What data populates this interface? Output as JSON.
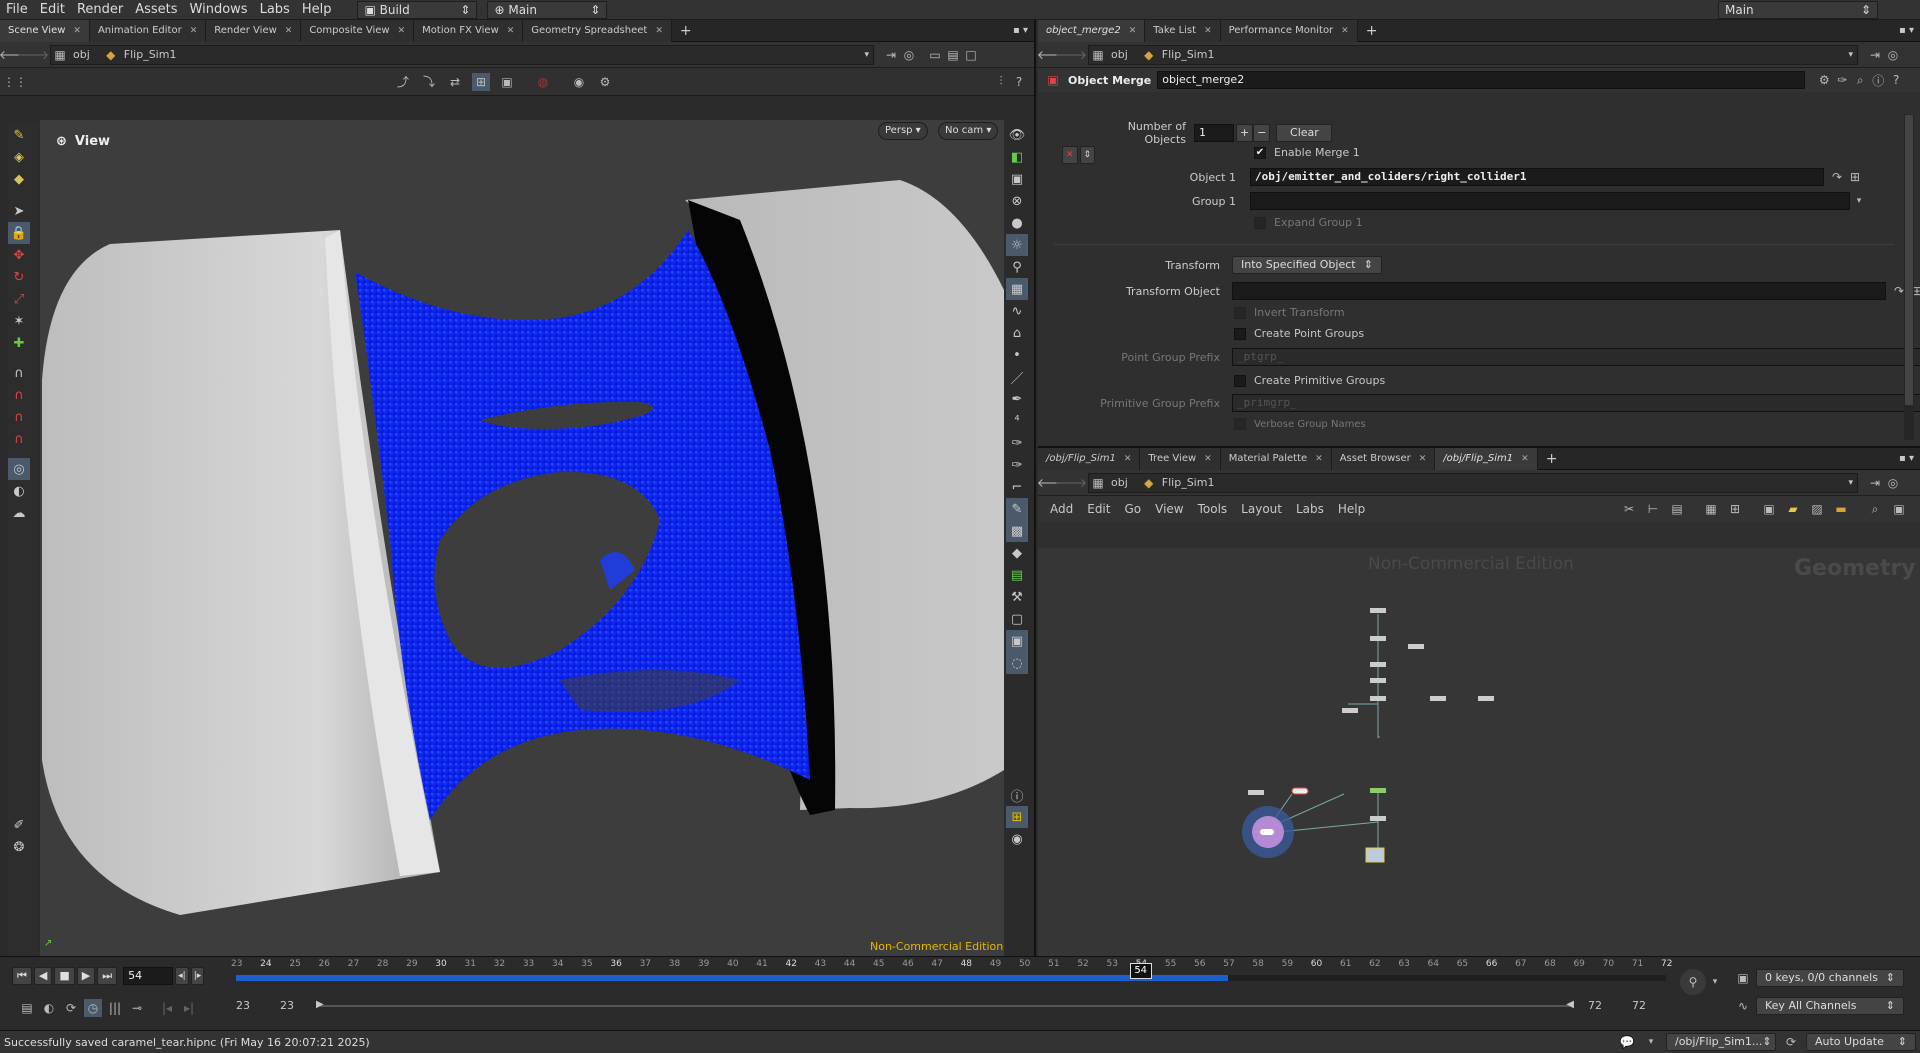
{
  "menubar": {
    "items": [
      "File",
      "Edit",
      "Render",
      "Assets",
      "Windows",
      "Labs",
      "Help"
    ],
    "desktop": "Build",
    "network": "Main",
    "right_desktop": "Main"
  },
  "left_tabs": [
    "Scene View",
    "Animation Editor",
    "Render View",
    "Composite View",
    "Motion FX View",
    "Geometry Spreadsheet"
  ],
  "right_top_tabs": [
    "object_merge2",
    "Take List",
    "Performance Monitor"
  ],
  "right_bottom_tabs": [
    "/obj/Flip_Sim1",
    "Tree View",
    "Material Palette",
    "Asset Browser",
    "/obj/Flip_Sim1"
  ],
  "path": {
    "root": "obj",
    "node": "Flip_Sim1"
  },
  "viewport": {
    "title": "View",
    "persp": "Persp",
    "cam": "No cam",
    "watermark": "Non-Commercial Edition",
    "particle_color": "#0a1fe0"
  },
  "params": {
    "node_type": "Object Merge",
    "node_name": "object_merge2",
    "num_objects_label": "Number of Objects",
    "num_objects": "1",
    "clear": "Clear",
    "enable_merge": "Enable Merge 1",
    "object1_label": "Object 1",
    "object1_value": "/obj/emitter_and_coliders/right_collider1",
    "group1_label": "Group 1",
    "expand_group": "Expand Group 1",
    "transform_label": "Transform",
    "transform_value": "Into Specified Object",
    "transform_object_label": "Transform Object",
    "invert_transform": "Invert Transform",
    "create_point_groups": "Create Point Groups",
    "point_group_prefix_label": "Point Group Prefix",
    "point_group_prefix": "_ptgrp_",
    "create_prim_groups": "Create Primitive Groups",
    "prim_group_prefix_label": "Primitive Group Prefix",
    "prim_group_prefix": "_primgrp_",
    "verbose_group_names": "Verbose Group Names"
  },
  "network": {
    "menu": [
      "Add",
      "Edit",
      "Go",
      "View",
      "Tools",
      "Layout",
      "Labs",
      "Help"
    ],
    "watermark": "Non-Commercial Edition",
    "context": "Geometry"
  },
  "timeline": {
    "current_frame": "54",
    "start": 23,
    "end": 72,
    "playback_end": 57,
    "range_start": "23",
    "range_start2": "23",
    "range_end": "72",
    "range_end2": "72",
    "keys": "0 keys, 0/0 channels",
    "key_all": "Key All Channels"
  },
  "status": {
    "message": "Successfully saved caramel_tear.hipnc (Fri May 16 20:07:21 2025)",
    "path": "/obj/Flip_Sim1...",
    "update": "Auto Update"
  }
}
